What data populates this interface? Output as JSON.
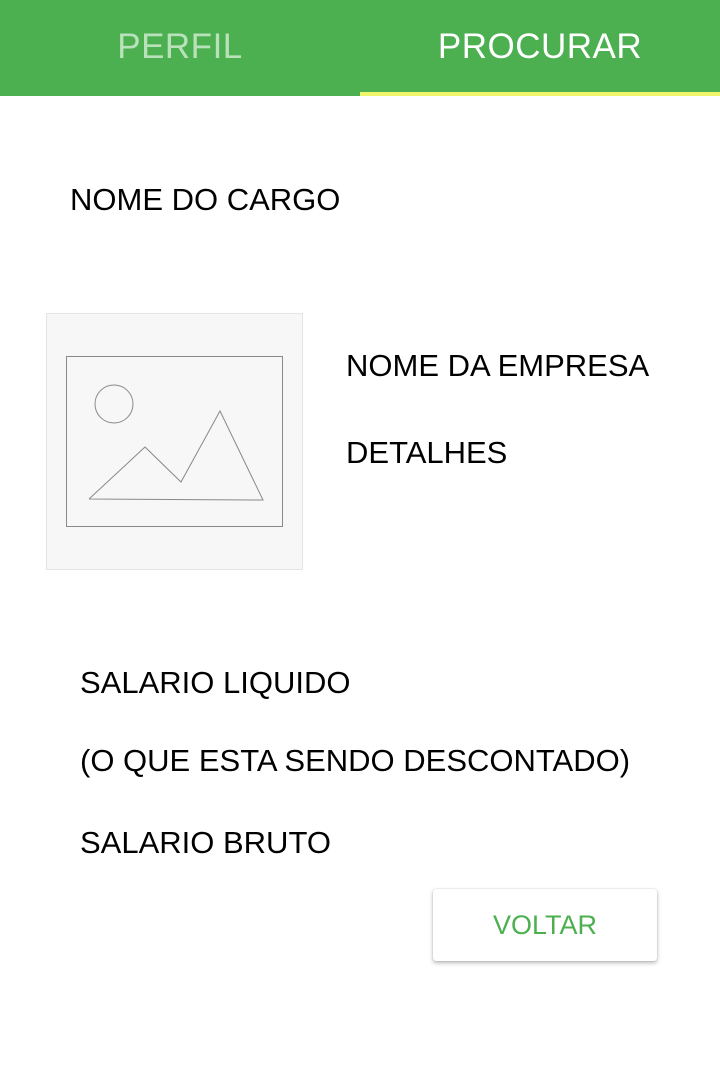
{
  "tabs": {
    "profile": {
      "label": "PERFIL",
      "active": false
    },
    "search": {
      "label": "PROCURAR",
      "active": true
    }
  },
  "job": {
    "title": "NOME DO CARGO",
    "company_name": "NOME DA EMPRESA",
    "details": "DETALHES",
    "image_icon": "image-placeholder-icon"
  },
  "salary": {
    "net": "SALARIO LIQUIDO",
    "deductions": "(O QUE ESTA SENDO DESCONTADO)",
    "gross": "SALARIO BRUTO"
  },
  "actions": {
    "back_label": "VOLTAR"
  },
  "colors": {
    "primary": "#4caf50",
    "tab_inactive_text": "#b9e2bb",
    "tab_indicator": "#eef56a",
    "button_text": "#4caf50"
  }
}
